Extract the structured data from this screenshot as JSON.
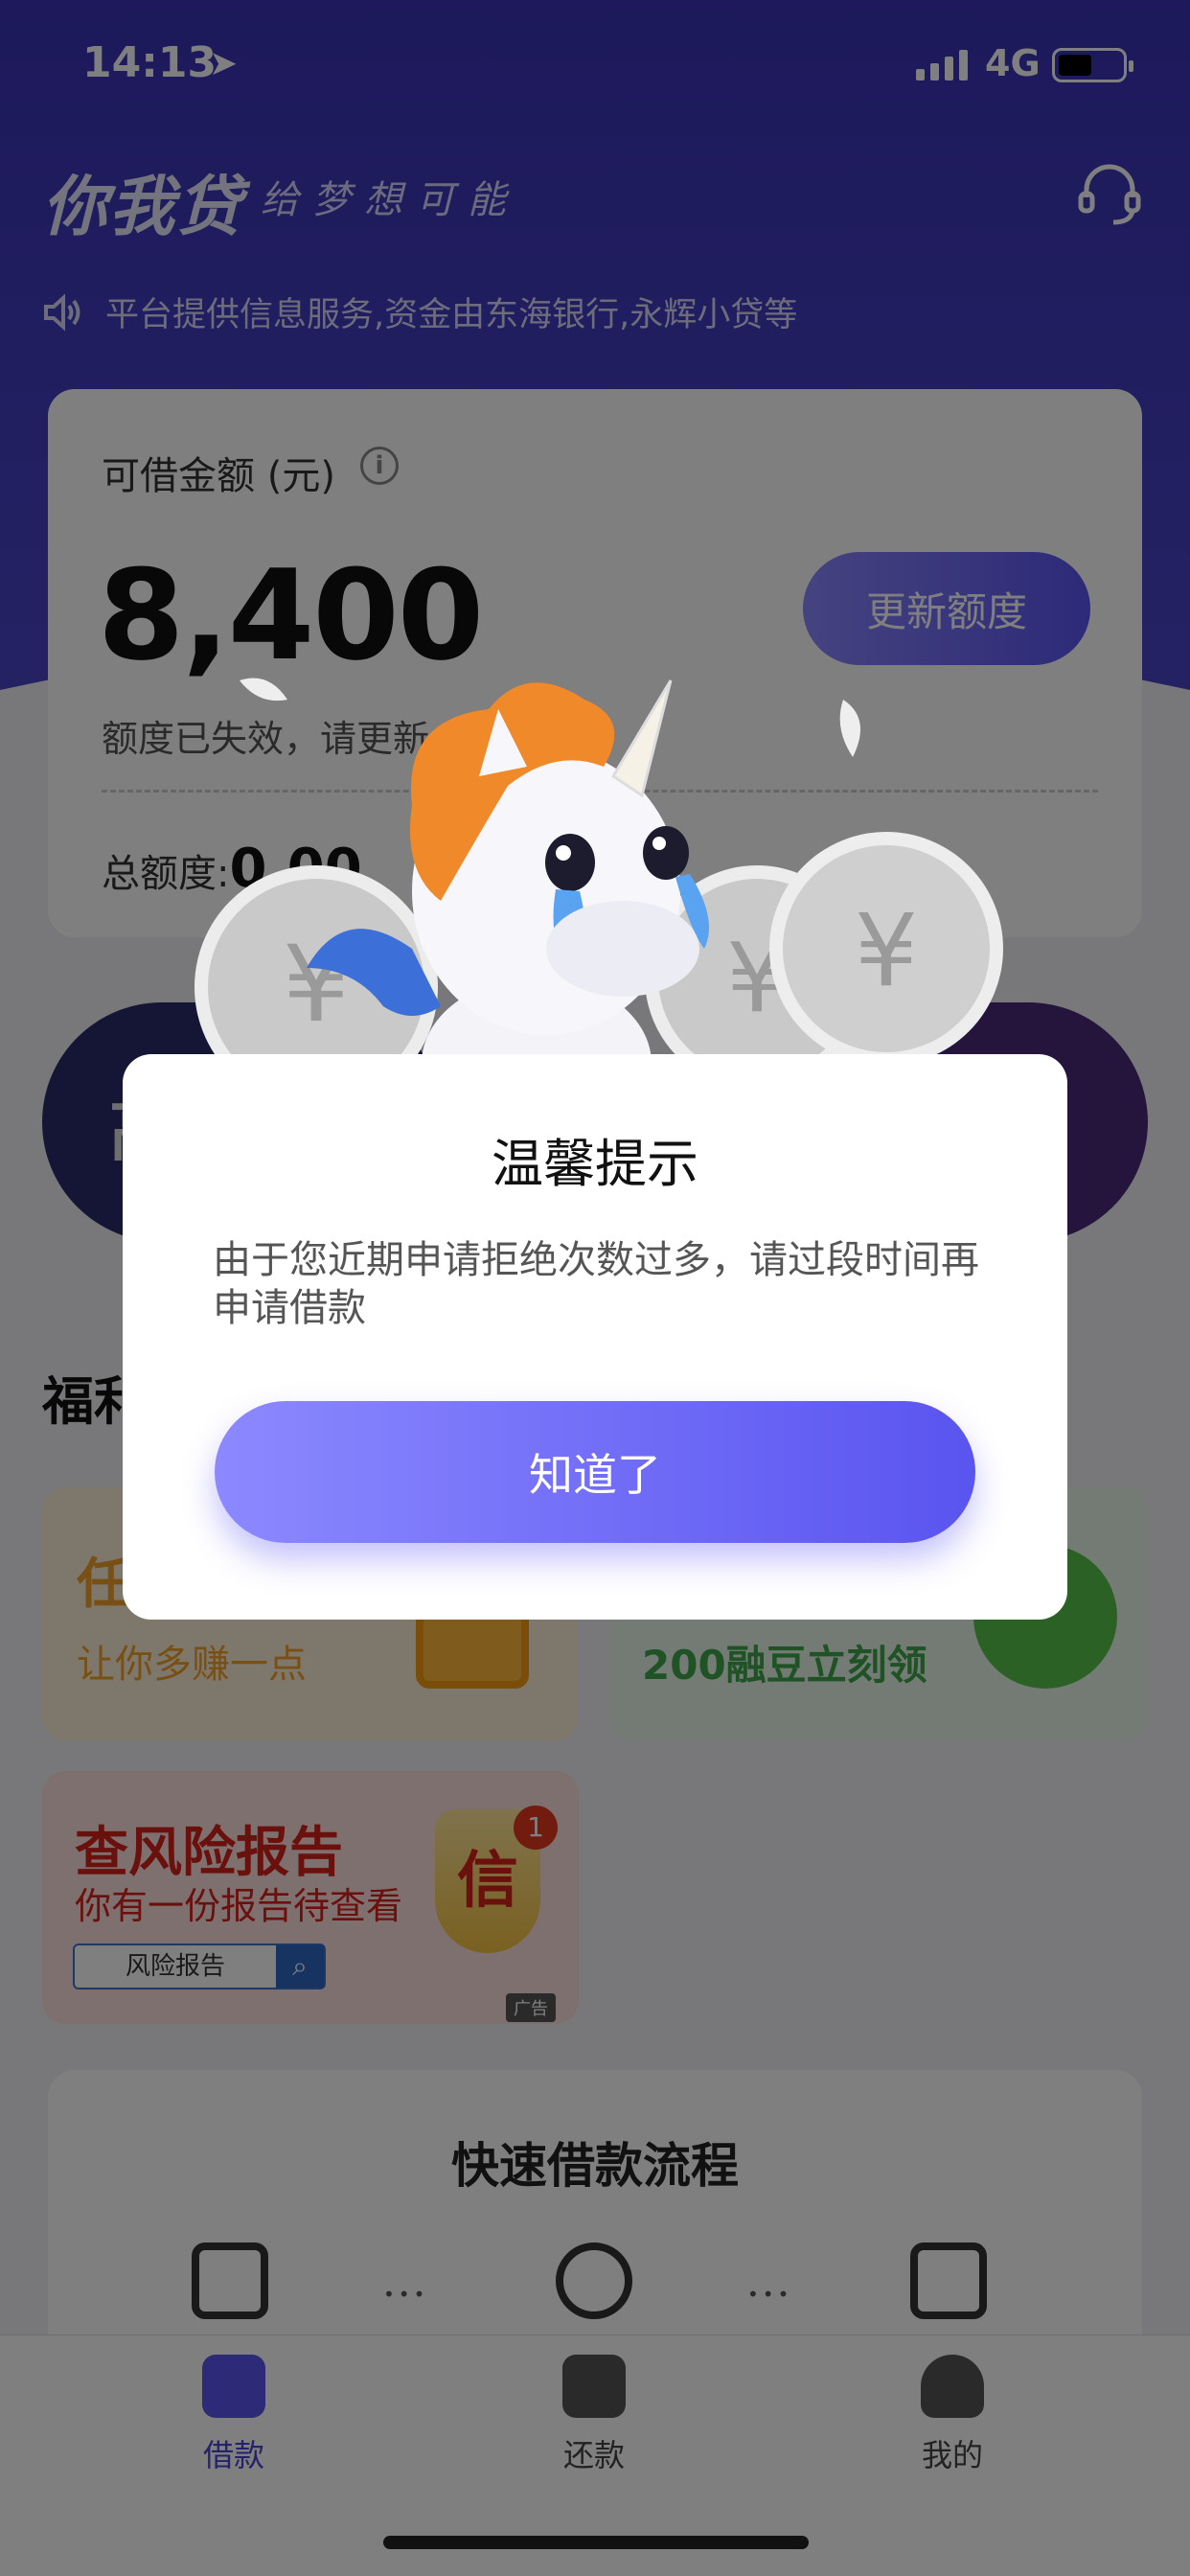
{
  "status_bar": {
    "time": "14:13",
    "network": "4G"
  },
  "header": {
    "brand": "你我贷",
    "slogan": "给梦想可能",
    "notice": "平台提供信息服务,资金由东海银行,永辉小贷等"
  },
  "quota": {
    "label": "可借金额 (元)",
    "amount": "8,400",
    "update_button": "更新额度",
    "expired_text": "额度已失效，请更新",
    "total_label": "总额度:",
    "total_value": "0.00"
  },
  "banners": {
    "left_text": "高",
    "right_text": ""
  },
  "section": {
    "title": "福利"
  },
  "promos": {
    "task_title": "任",
    "task_sub": "让你多赚一点",
    "wechat_sub": "200融豆立刻领",
    "risk_title": "查风险报告",
    "risk_sub": "你有一份报告待查看",
    "risk_search_label": "风险报告",
    "risk_shield_char": "信",
    "risk_badge": "1",
    "ad_tag": "广告"
  },
  "flow": {
    "title": "快速借款流程"
  },
  "tabbar": {
    "items": [
      {
        "label": "借款"
      },
      {
        "label": "还款"
      },
      {
        "label": "我的"
      }
    ]
  },
  "dialog": {
    "title": "温馨提示",
    "message": "由于您近期申请拒绝次数过多，请过段时间再申请借款",
    "button": "知道了"
  },
  "colors": {
    "primary": "#4b45d9",
    "header": "#3a33b8",
    "button_end": "#5a54f0"
  }
}
